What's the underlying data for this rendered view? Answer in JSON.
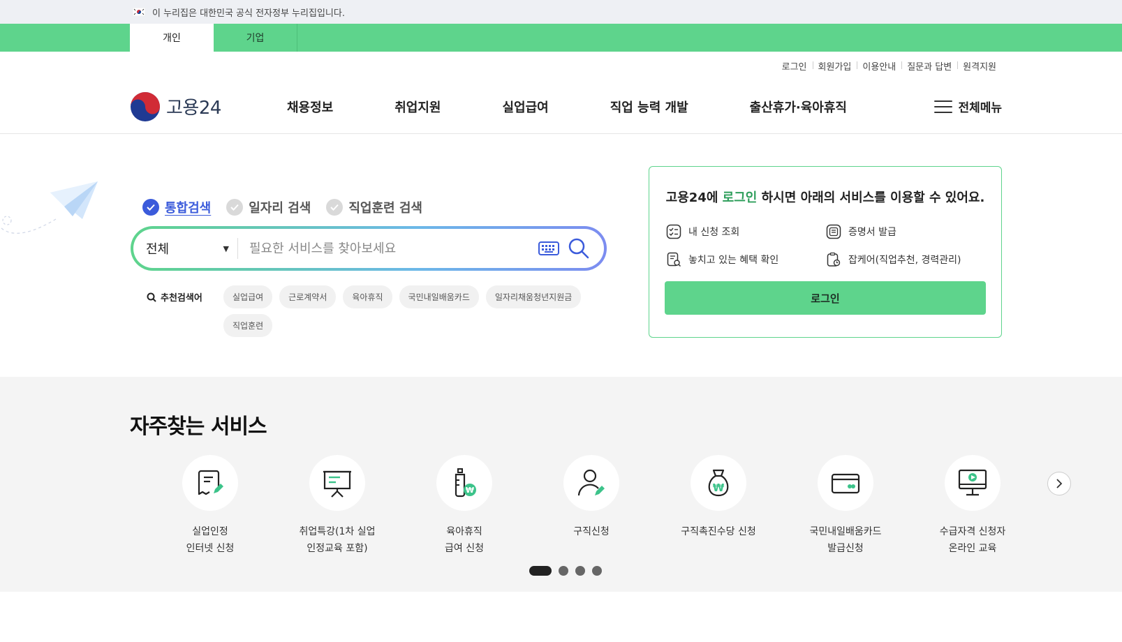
{
  "gov_banner": {
    "text": "이 누리집은 대한민국 공식 전자정부 누리집입니다."
  },
  "user_types": [
    {
      "label": "개인"
    },
    {
      "label": "기업"
    }
  ],
  "util_links": [
    "로그인",
    "회원가입",
    "이용안내",
    "질문과 답변",
    "원격지원"
  ],
  "brand": {
    "name": "고용24"
  },
  "nav": [
    "채용정보",
    "취업지원",
    "실업급여",
    "직업 능력 개발",
    "출산휴가·육아휴직"
  ],
  "all_menu_label": "전체메뉴",
  "search": {
    "tabs": [
      "통합검색",
      "일자리 검색",
      "직업훈련 검색"
    ],
    "scope_value": "전체",
    "placeholder": "필요한 서비스를 찾아보세요",
    "recommend_label": "추천검색어",
    "keywords": [
      "실업급여",
      "근로계약서",
      "육아휴직",
      "국민내일배움카드",
      "일자리채움청년지원금",
      "직업훈련"
    ]
  },
  "login_card": {
    "title_pre": "고용24에 ",
    "title_link": "로그인",
    "title_post": " 하시면 아래의 서비스를 이용할 수 있어요.",
    "services": [
      "내 신청 조회",
      "증명서 발급",
      "놓치고 있는 혜택 확인",
      "잡케어(직업추천, 경력관리)"
    ],
    "button": "로그인"
  },
  "frequent": {
    "title": "자주찾는 서비스",
    "items": [
      {
        "label": "실업인정\n인터넷 신청",
        "icon": "document-edit-icon"
      },
      {
        "label": "취업특강(1차 실업\n인정교육 포함)",
        "icon": "presentation-board-icon"
      },
      {
        "label": "육아휴직\n급여 신청",
        "icon": "baby-bottle-icon"
      },
      {
        "label": "구직신청",
        "icon": "person-edit-icon"
      },
      {
        "label": "구직촉진수당 신청",
        "icon": "money-bag-icon"
      },
      {
        "label": "국민내일배움카드\n발급신청",
        "icon": "card-icon"
      },
      {
        "label": "수급자격 신청자\n온라인 교육",
        "icon": "monitor-play-icon"
      }
    ],
    "page_count": 4,
    "active_page": 1
  },
  "colors": {
    "accent_green": "#5ed48c",
    "link_blue": "#3b5bdb",
    "highlight_green": "#2e9e5b"
  }
}
